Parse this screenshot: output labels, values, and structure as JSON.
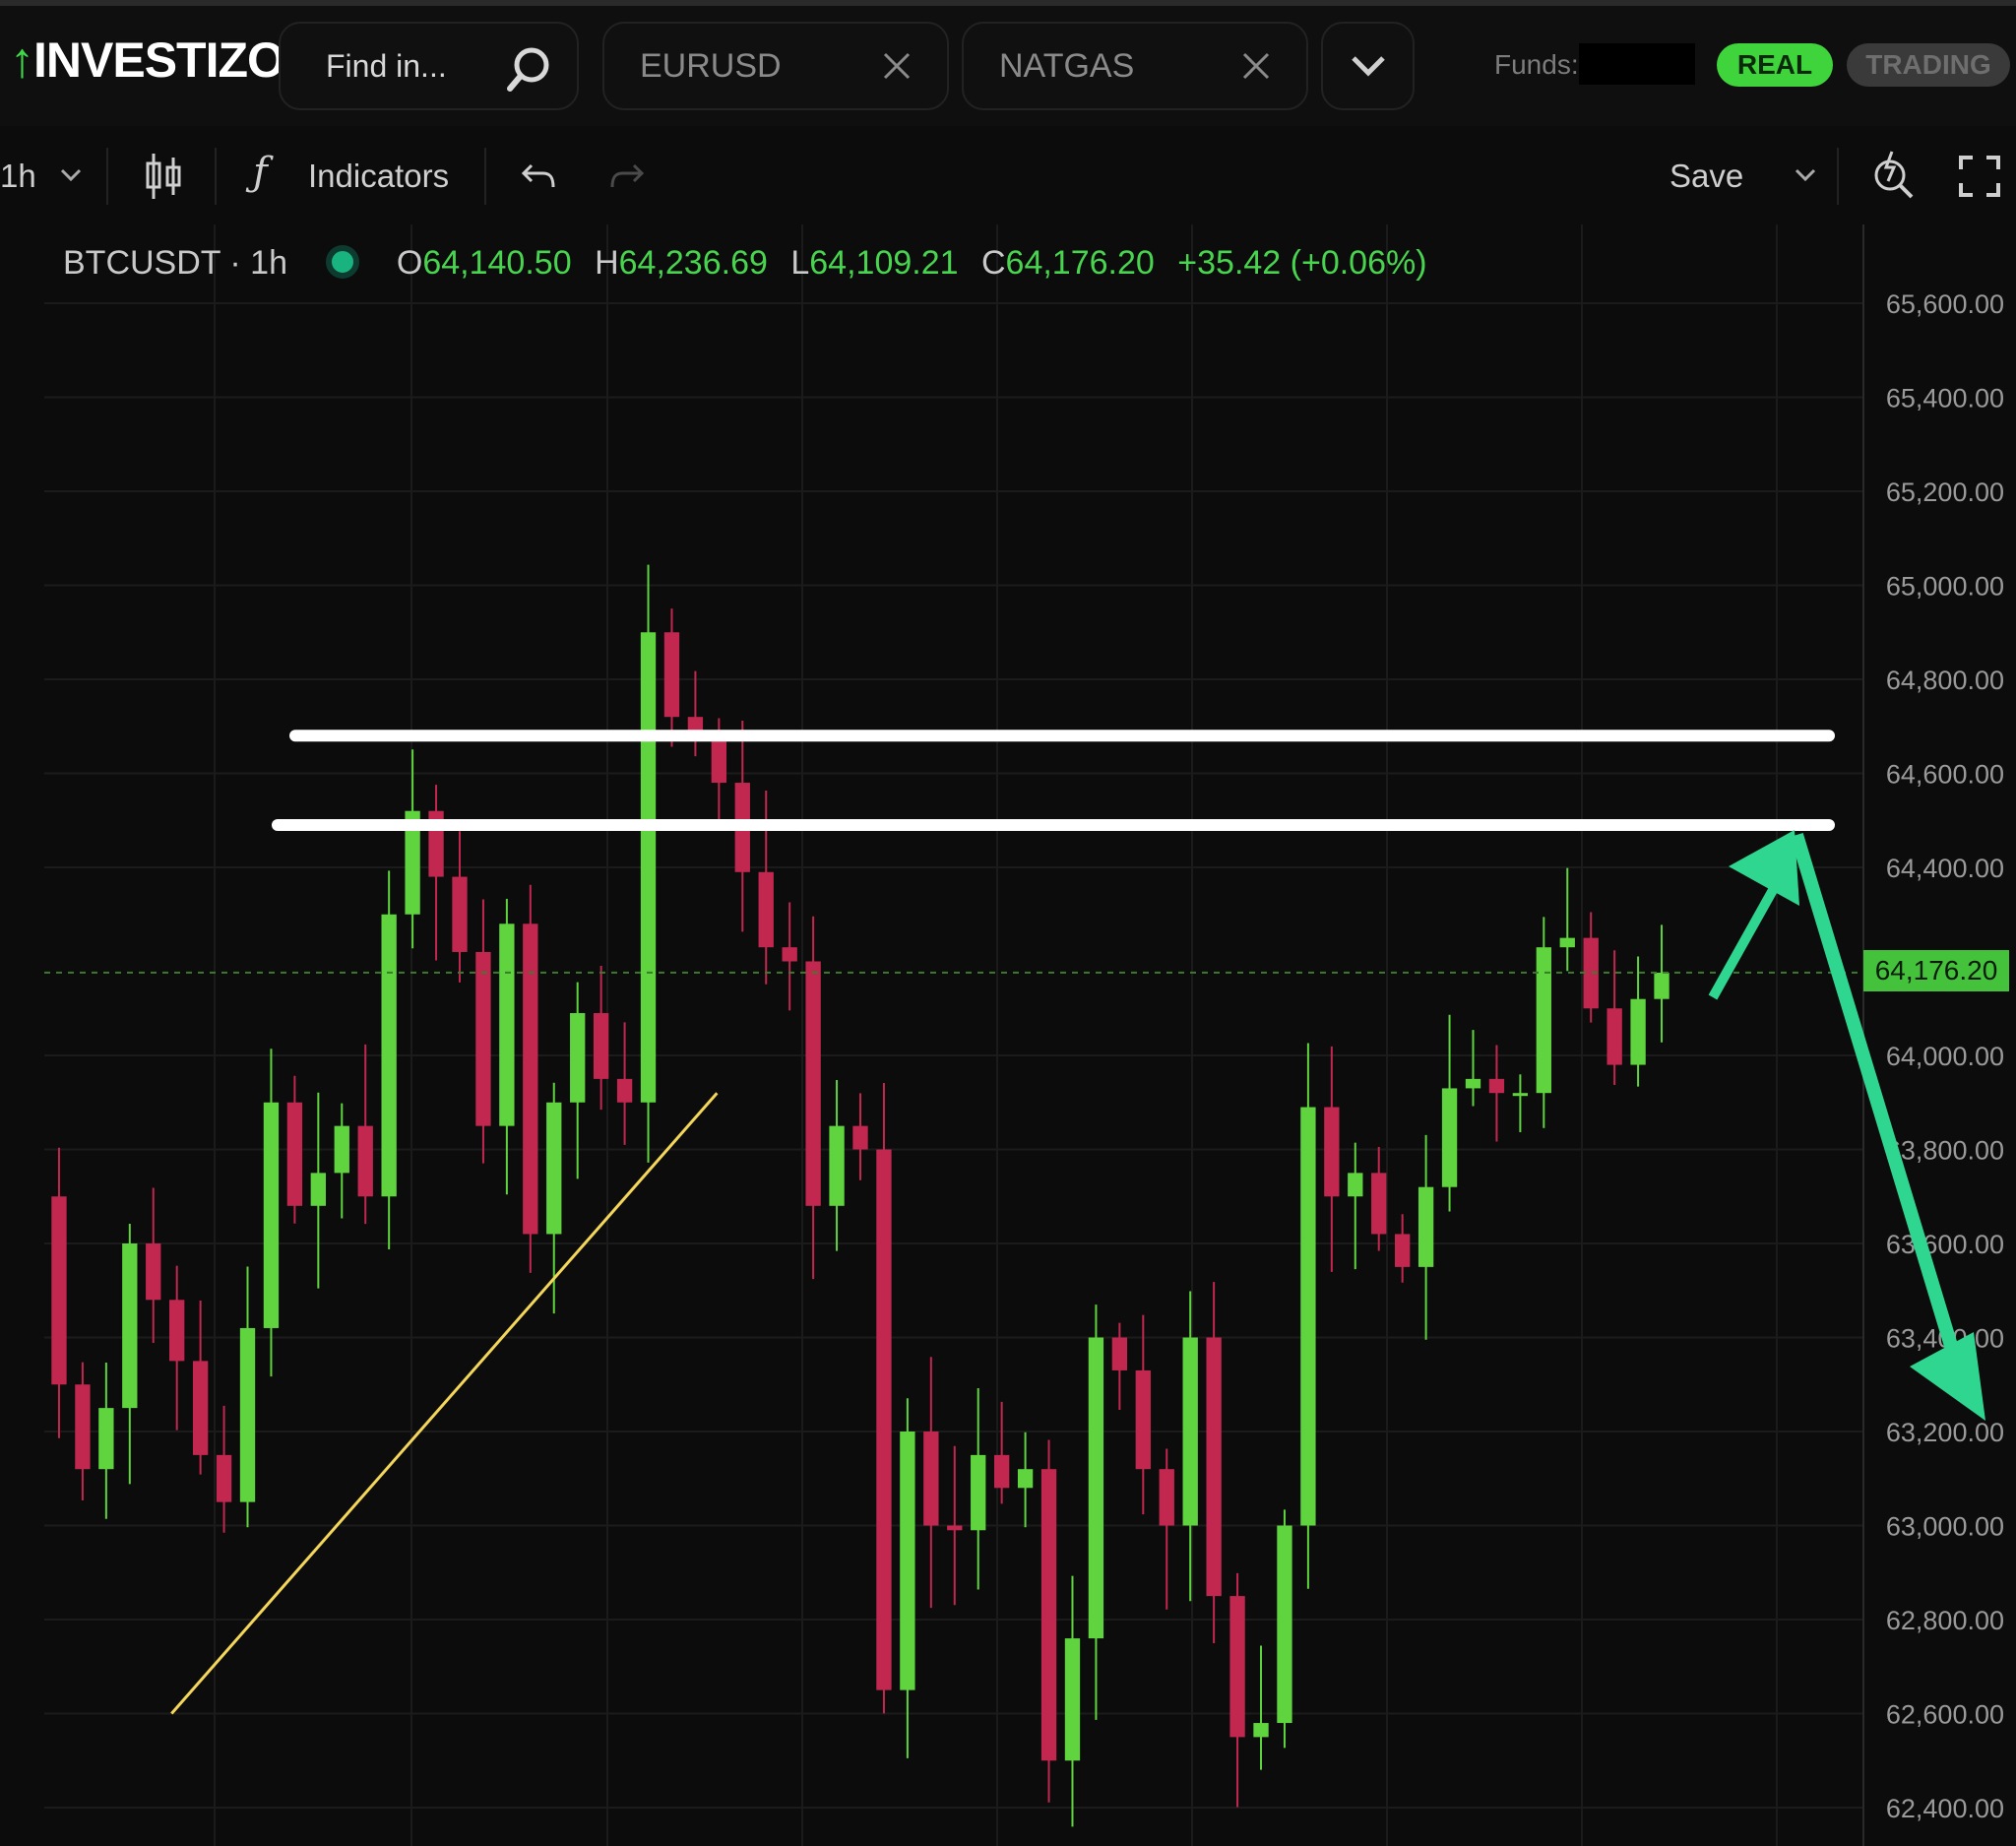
{
  "app": {
    "logo_text": "INVESTIZO",
    "search_placeholder": "Find in...",
    "tabs": [
      {
        "label": "EURUSD"
      },
      {
        "label": "NATGAS"
      }
    ],
    "funds_label": "Funds:",
    "mode_real": "REAL",
    "mode_trading": "TRADING"
  },
  "toolbar": {
    "interval": "1h",
    "indicators_label": "Indicators",
    "save_label": "Save"
  },
  "legend": {
    "symbol": "BTCUSDT · 1h",
    "open_key": "O",
    "open": "64,140.50",
    "high_key": "H",
    "high": "64,236.69",
    "low_key": "L",
    "low": "64,109.21",
    "close_key": "C",
    "close": "64,176.20",
    "change": "+35.42 (+0.06%)"
  },
  "colors": {
    "up": "#5fd43e",
    "down": "#c2284f",
    "accent": "#3fd43b",
    "annotation_arrow": "#2fd68f",
    "trendline": "#f3d65a"
  },
  "chart_data": {
    "type": "candlestick",
    "symbol": "BTCUSDT",
    "interval": "1h",
    "ylim": [
      62350,
      65700
    ],
    "yticks": [
      "65,600.00",
      "65,400.00",
      "65,200.00",
      "65,000.00",
      "64,800.00",
      "64,600.00",
      "64,400.00",
      "64,000.00",
      "63,800.00",
      "63,600.00",
      "63,400.00",
      "63,200.00",
      "63,000.00",
      "62,800.00",
      "62,600.00",
      "62,400.00"
    ],
    "yticks_values": [
      65600,
      65400,
      65200,
      65000,
      64800,
      64600,
      64400,
      64000,
      63800,
      63600,
      63400,
      63200,
      63000,
      62800,
      62600,
      62400
    ],
    "last_price": 64176.2,
    "last_price_label": "64,176.20",
    "closes": [
      63300,
      63120,
      63250,
      63600,
      63480,
      63350,
      63150,
      63050,
      63420,
      63900,
      63680,
      63750,
      63850,
      63700,
      64300,
      64520,
      64380,
      64220,
      63850,
      64280,
      63620,
      63900,
      64090,
      63950,
      63900,
      64900,
      64720,
      64680,
      64580,
      64390,
      64230,
      64200,
      63680,
      63850,
      63800,
      62650,
      63200,
      63000,
      62990,
      63150,
      63080,
      63120,
      62500,
      62760,
      63400,
      63330,
      63120,
      63000,
      63400,
      62850,
      62550,
      62580,
      63000,
      63890,
      63700,
      63750,
      63620,
      63550,
      63720,
      63930,
      63950,
      63920,
      63920,
      64230,
      64250,
      64100,
      63980,
      64120,
      64176
    ],
    "annotations": {
      "resistance_levels": [
        64680,
        64490
      ],
      "trendline_points": [
        [
          0.07,
          62600
        ],
        [
          0.37,
          63920
        ]
      ],
      "arrows": [
        "up-right",
        "down-right"
      ]
    }
  }
}
